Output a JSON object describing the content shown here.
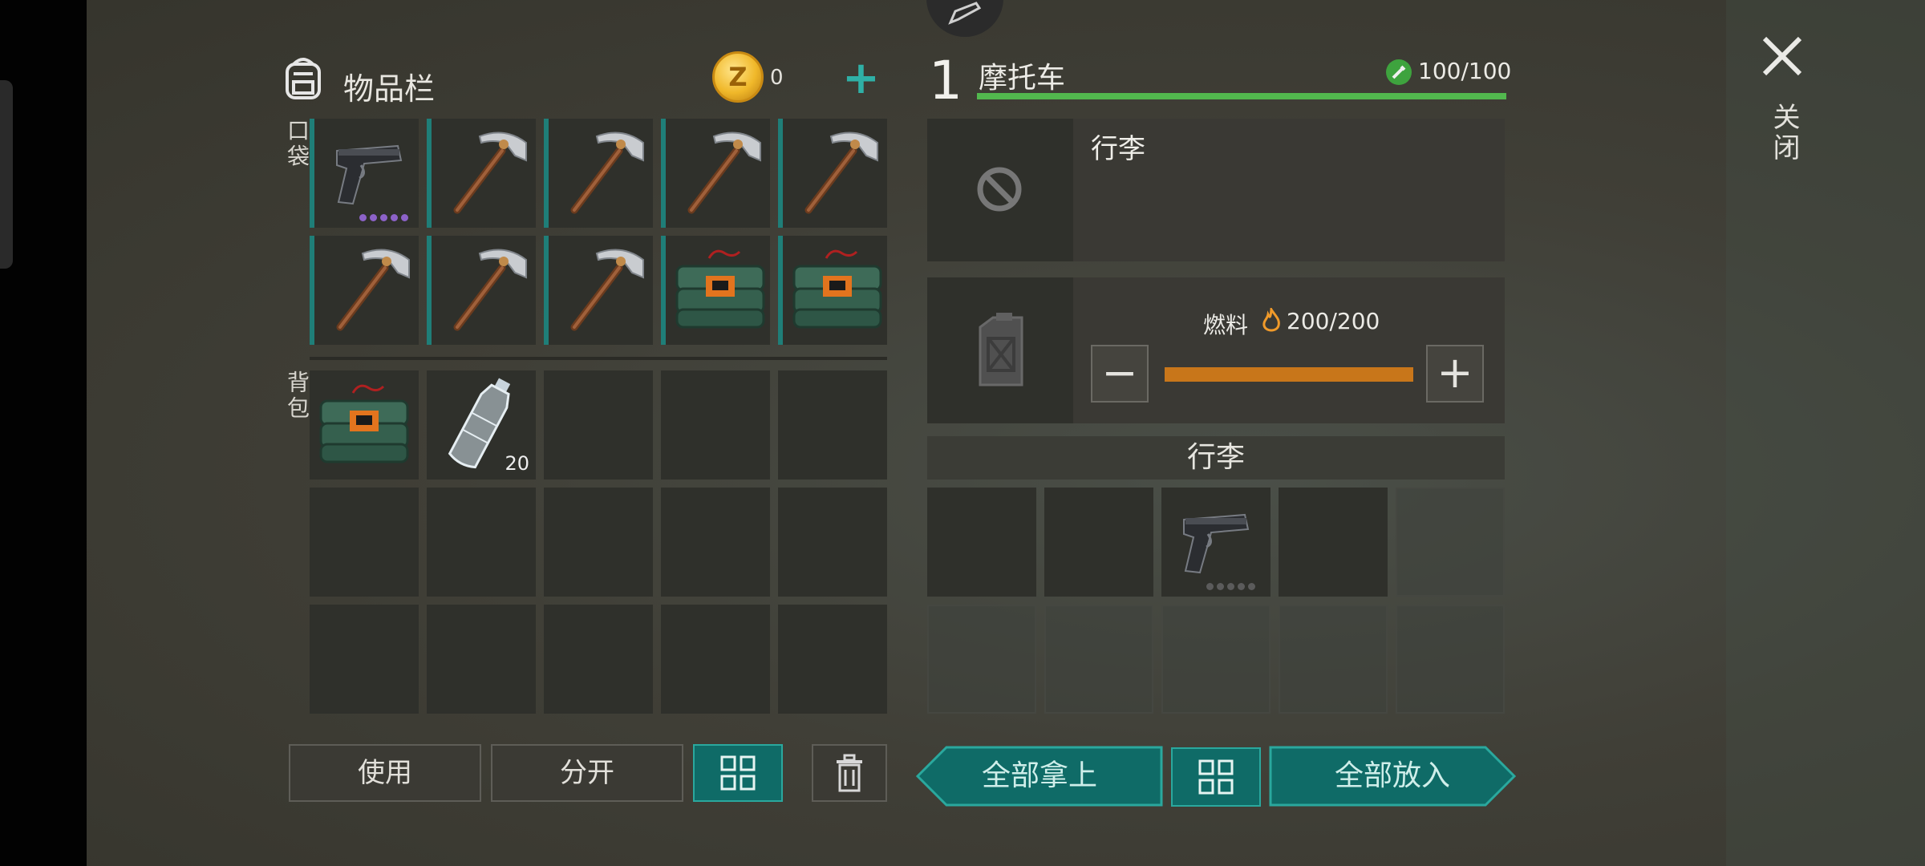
{
  "inventory": {
    "title": "物品栏",
    "coin_symbol": "Z",
    "coin_count": "0",
    "add_label": "+",
    "pocket_label": "口袋",
    "backpack_label": "背包",
    "pocket_slots": [
      {
        "item": "pistol",
        "durability_dots": 5
      },
      {
        "item": "pickaxe"
      },
      {
        "item": "pickaxe"
      },
      {
        "item": "pickaxe"
      },
      {
        "item": "pickaxe"
      },
      {
        "item": "pickaxe"
      },
      {
        "item": "pickaxe"
      },
      {
        "item": "pickaxe"
      },
      {
        "item": "explosive-crate"
      },
      {
        "item": "explosive-crate"
      }
    ],
    "backpack_slots": [
      {
        "item": "explosive-crate"
      },
      {
        "item": "water-bottle",
        "count": "20"
      }
    ],
    "backpack_slot_total": 15
  },
  "actions": {
    "use_label": "使用",
    "split_label": "分开",
    "sort_icon": "grid-sort-icon",
    "trash_icon": "trash-icon"
  },
  "vehicle": {
    "slot_number": "1",
    "name": "摩托车",
    "hp_text": "100/100",
    "hp_fraction": 1.0,
    "luggage_title": "行李",
    "luggage_slot_icon": "blocked-icon",
    "fuel_icon": "jerrycan-icon",
    "fuel_label": "燃料",
    "fuel_text": "200/200",
    "fuel_fraction": 1.0,
    "minus_label": "−",
    "plus_label": "+",
    "storage_header": "行李",
    "storage_slots": [
      {
        "item": null
      },
      {
        "item": null
      },
      {
        "item": "pistol",
        "durability_dots": 5
      },
      {
        "item": null
      },
      {
        "item": null
      },
      {
        "item": null
      },
      {
        "item": null
      },
      {
        "item": null
      },
      {
        "item": null
      },
      {
        "item": null
      }
    ],
    "take_all_label": "全部拿上",
    "put_all_label": "全部放入"
  },
  "close": {
    "label": "关闭"
  },
  "colors": {
    "teal": "#2aa89e",
    "hp_green": "#52b84e",
    "fuel_orange": "#c8761a",
    "rarity_purple": "#8c62c8"
  }
}
